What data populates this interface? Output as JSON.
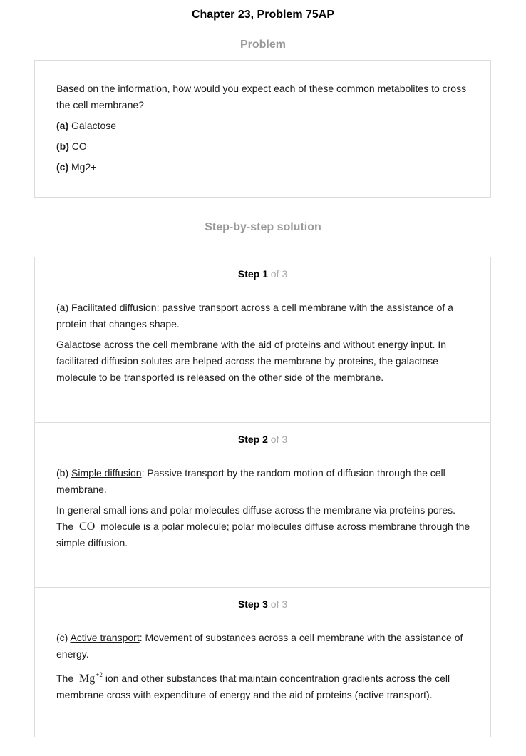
{
  "page": {
    "title": "Chapter 23, Problem 75AP"
  },
  "problem": {
    "heading": "Problem",
    "question": "Based on the information, how would you expect each of these common metabolites to cross the cell membrane?",
    "options": [
      {
        "letter": "(a)",
        "text": "Galactose"
      },
      {
        "letter": "(b)",
        "text": "CO"
      },
      {
        "letter": "(c)",
        "text": "Mg2+"
      }
    ]
  },
  "solution": {
    "heading": "Step-by-step solution",
    "steps": [
      {
        "label": "Step",
        "number": "1",
        "of": "of 3",
        "prefix": "(a) ",
        "term": "Facilitated diffusion",
        "definition": ": passive transport across a cell membrane with the assistance of a protein that changes shape.",
        "explanation": "Galactose across the cell membrane with the aid of proteins and without energy input. In facilitated diffusion solutes are helped across the membrane by proteins, the galactose molecule to be transported is released on the other side of the membrane."
      },
      {
        "label": "Step",
        "number": "2",
        "of": "of 3",
        "prefix": "(b) ",
        "term": "Simple diffusion",
        "definition": ": Passive transport by the random motion of diffusion through the cell membrane.",
        "explanation_1": "In general small ions and polar molecules diffuse across the membrane via proteins pores.",
        "explanation_2_pre": "The",
        "formula": "CO",
        "explanation_2_post": "molecule is a polar molecule; polar molecules diffuse across membrane through the simple diffusion."
      },
      {
        "label": "Step",
        "number": "3",
        "of": "of 3",
        "prefix": "(c) ",
        "term": "Active transport",
        "definition": ": Movement of substances across a cell membrane with the assistance of energy.",
        "explanation_pre": "The",
        "formula_base": "Mg",
        "formula_sup": "+2",
        "explanation_post": "ion and other substances that maintain concentration gradients across the cell membrane cross with expenditure of energy and the aid of proteins (active transport)."
      }
    ]
  }
}
